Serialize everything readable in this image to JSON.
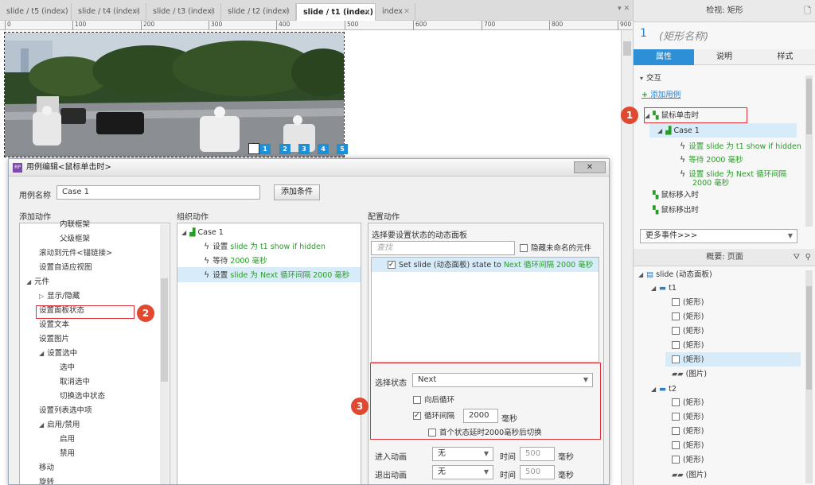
{
  "tabs": [
    {
      "label": "slide / t5 (index)",
      "active": false
    },
    {
      "label": "slide / t4 (index)",
      "active": false
    },
    {
      "label": "slide / t3 (index)",
      "active": false
    },
    {
      "label": "slide / t2 (index)",
      "active": false
    },
    {
      "label": "slide / t1 (index)",
      "active": true
    },
    {
      "label": "index",
      "active": false
    }
  ],
  "ruler": [
    "0",
    "100",
    "200",
    "300",
    "400",
    "500",
    "600",
    "700",
    "800",
    "900"
  ],
  "slide_dots": [
    "1",
    "2",
    "3",
    "4",
    "5"
  ],
  "inspector": {
    "title": "检视: 矩形",
    "shape_index": "1",
    "shape_name": "(矩形名称)",
    "tabs": [
      "属性",
      "说明",
      "样式"
    ],
    "section": "交互",
    "add_case": "添加用例",
    "events": {
      "click": "鼠标单击时",
      "case": "Case 1",
      "actions": [
        "设置 slide 为 t1 show if hidden",
        "等待 2000 毫秒",
        "设置 slide 为 Next 循环间隔",
        "2000 毫秒"
      ],
      "enter": "鼠标移入时",
      "leave": "鼠标移出时"
    },
    "more_events": "更多事件>>>"
  },
  "outline": {
    "title": "概要: 页面",
    "root": "slide (动态面板)",
    "t1": "t1",
    "t1_items": [
      "(矩形)",
      "(矩形)",
      "(矩形)",
      "(矩形)",
      "(矩形)",
      "(图片)"
    ],
    "t2": "t2",
    "t2_items": [
      "(矩形)",
      "(矩形)",
      "(矩形)",
      "(矩形)",
      "(矩形)",
      "(图片)"
    ]
  },
  "dialog": {
    "title": "用例编辑<鼠标单击时>",
    "case_name_label": "用例名称",
    "case_name_value": "Case 1",
    "add_condition": "添加条件",
    "col_add": "添加动作",
    "col_org": "组织动作",
    "col_cfg": "配置动作",
    "actions_tree": [
      {
        "text": "内联框架",
        "indent": 3
      },
      {
        "text": "父级框架",
        "indent": 3
      },
      {
        "text": "滚动到元件<锚链接>",
        "indent": 2
      },
      {
        "text": "设置自适应视图",
        "indent": 2
      },
      {
        "text": "元件",
        "indent": 1,
        "arrow": "◢"
      },
      {
        "text": "显示/隐藏",
        "indent": 2,
        "arrow": "▷"
      },
      {
        "text": "设置面板状态",
        "indent": 2
      },
      {
        "text": "设置文本",
        "indent": 2
      },
      {
        "text": "设置图片",
        "indent": 2
      },
      {
        "text": "设置选中",
        "indent": 2,
        "arrow": "◢"
      },
      {
        "text": "选中",
        "indent": 3
      },
      {
        "text": "取消选中",
        "indent": 3
      },
      {
        "text": "切换选中状态",
        "indent": 3
      },
      {
        "text": "设置列表选中项",
        "indent": 2
      },
      {
        "text": "启用/禁用",
        "indent": 2,
        "arrow": "◢"
      },
      {
        "text": "启用",
        "indent": 3
      },
      {
        "text": "禁用",
        "indent": 3
      },
      {
        "text": "移动",
        "indent": 2
      },
      {
        "text": "旋转",
        "indent": 2
      }
    ],
    "org_case": "Case 1",
    "org_actions": [
      {
        "prefix": "设置 ",
        "green": "slide 为 t1 show if hidden"
      },
      {
        "prefix": "等待 ",
        "green": "2000 毫秒"
      },
      {
        "prefix": "设置 ",
        "green": "slide 为 Next 循环间隔 2000 毫秒"
      }
    ],
    "cfg_prompt": "选择要设置状态的动态面板",
    "search_placeholder": "查找",
    "hide_unnamed": "隐藏未命名的元件",
    "panel_row_prefix": "Set slide (动态面板) state to ",
    "panel_row_green": "Next 循环间隔 2000 毫秒",
    "state_label": "选择状态",
    "state_value": "Next",
    "opt_loop_back": "向后循环",
    "opt_interval": "循环间隔",
    "interval_value": "2000",
    "interval_unit": "毫秒",
    "opt_first_delay": "首个状态延时2000毫秒后切换",
    "enter_anim_label": "进入动画",
    "exit_anim_label": "退出动画",
    "anim_value": "无",
    "time_label": "时间",
    "time_value": "500",
    "ms": "毫秒"
  },
  "markers": [
    "1",
    "2",
    "3"
  ]
}
